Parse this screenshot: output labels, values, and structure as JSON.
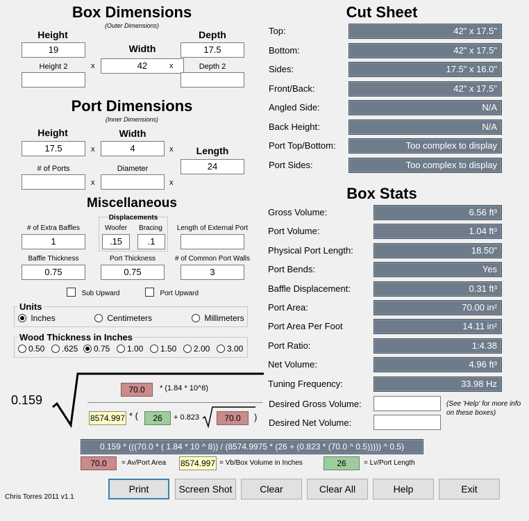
{
  "box": {
    "title": "Box Dimensions",
    "subtitle": "(Outer Dimensions)",
    "height_label": "Height",
    "width_label": "Width",
    "depth_label": "Depth",
    "height_value": "19",
    "width_value": "42",
    "depth_value": "17.5",
    "height2_label": "Height 2",
    "depth2_label": "Depth 2",
    "height2_value": "",
    "depth2_value": "",
    "x": "x"
  },
  "port": {
    "title": "Port Dimensions",
    "subtitle": "(Inner Dimensions)",
    "height_label": "Height",
    "width_label": "Width",
    "length_label": "Length",
    "height_value": "17.5",
    "width_value": "4",
    "length_value": "24",
    "num_ports_label": "# of Ports",
    "diameter_label": "Diameter",
    "num_ports_value": "",
    "diameter_value": ""
  },
  "misc": {
    "title": "Miscellaneous",
    "extra_baffles_label": "# of Extra Baffles",
    "extra_baffles_value": "1",
    "displacements_label": "Displacements",
    "woofer_label": "Woofer",
    "bracing_label": "Bracing",
    "woofer_value": ".15",
    "bracing_value": ".1",
    "ext_port_label": "Length of External Port",
    "ext_port_value": "",
    "baffle_thickness_label": "Baffle Thickness",
    "baffle_thickness_value": "0.75",
    "port_thickness_label": "Port Thickness",
    "port_thickness_value": "0.75",
    "common_walls_label": "# of Common Port Walls",
    "common_walls_value": "3",
    "sub_upward_label": "Sub Upward",
    "port_upward_label": "Port Upward"
  },
  "units": {
    "title": "Units",
    "options": [
      "Inches",
      "Centimeters",
      "Millimeters"
    ],
    "selected": "Inches"
  },
  "wood": {
    "title": "Wood Thickness in Inches",
    "options": [
      "0.50",
      ".625",
      "0.75",
      "1.00",
      "1.50",
      "2.00",
      "3.00"
    ],
    "selected": "0.75"
  },
  "cut_sheet": {
    "title": "Cut Sheet",
    "rows": [
      {
        "label": "Top:",
        "value": "42\" x 17.5\""
      },
      {
        "label": "Bottom:",
        "value": "42\" x 17.5\""
      },
      {
        "label": "Sides:",
        "value": "17.5\" x 16.0\""
      },
      {
        "label": "Front/Back:",
        "value": "42\" x 17.5\""
      },
      {
        "label": "Angled Side:",
        "value": "N/A"
      },
      {
        "label": "Back Height:",
        "value": "N/A"
      },
      {
        "label": "Port Top/Bottom:",
        "value": "Too complex to display"
      },
      {
        "label": "Port Sides:",
        "value": "Too complex to display"
      }
    ]
  },
  "box_stats": {
    "title": "Box Stats",
    "rows": [
      {
        "label": "Gross Volume:",
        "value": "6.56 ft³"
      },
      {
        "label": "Port Volume:",
        "value": "1.04 ft³"
      },
      {
        "label": "Physical Port Length:",
        "value": "18.50\""
      },
      {
        "label": "Port Bends:",
        "value": "Yes"
      },
      {
        "label": "Baffle Displacement:",
        "value": "0.31 ft³"
      },
      {
        "label": "Port Area:",
        "value": "70.00 in²"
      },
      {
        "label": "Port Area Per Foot",
        "value": "14.11 in²"
      },
      {
        "label": "Port Ratio:",
        "value": "1:4.38"
      },
      {
        "label": "Net Volume:",
        "value": "4.96 ft³"
      },
      {
        "label": "Tuning Frequency:",
        "value": "33.98 Hz"
      }
    ],
    "desired_gross_label": "Desired Gross Volume:",
    "desired_net_label": "Desired Net Volume:",
    "desired_gross_value": "",
    "desired_net_value": "",
    "help_note": "(See 'Help' for more info on these boxes)"
  },
  "formula": {
    "coef": "0.159",
    "av": "70.0",
    "num_suffix": "* (1.84 * 10^8)",
    "vb": "8574.997",
    "star_paren": "* (",
    "lv": "26",
    "plus_coef": "+ 0.823",
    "av2": "70.0",
    "close_paren": ")",
    "full": "0.159 * (((70.0 * ( 1.84 * 10 ^ 8)) / (8574.9975 * (26 + (0.823 * (70.0 ^ 0.5))))) ^ 0.5)",
    "legend_av": "70.0",
    "legend_av_label": "= Av/Port Area",
    "legend_vb": "8574.997",
    "legend_vb_label": "= Vb/Box Volume in Inches",
    "legend_lv": "26",
    "legend_lv_label": "= Lv/Port Length"
  },
  "footer": {
    "credit": "Chris Torres 2011 v1.1",
    "buttons": [
      "Print",
      "Screen Shot",
      "Clear",
      "Clear All",
      "Help",
      "Exit"
    ]
  }
}
